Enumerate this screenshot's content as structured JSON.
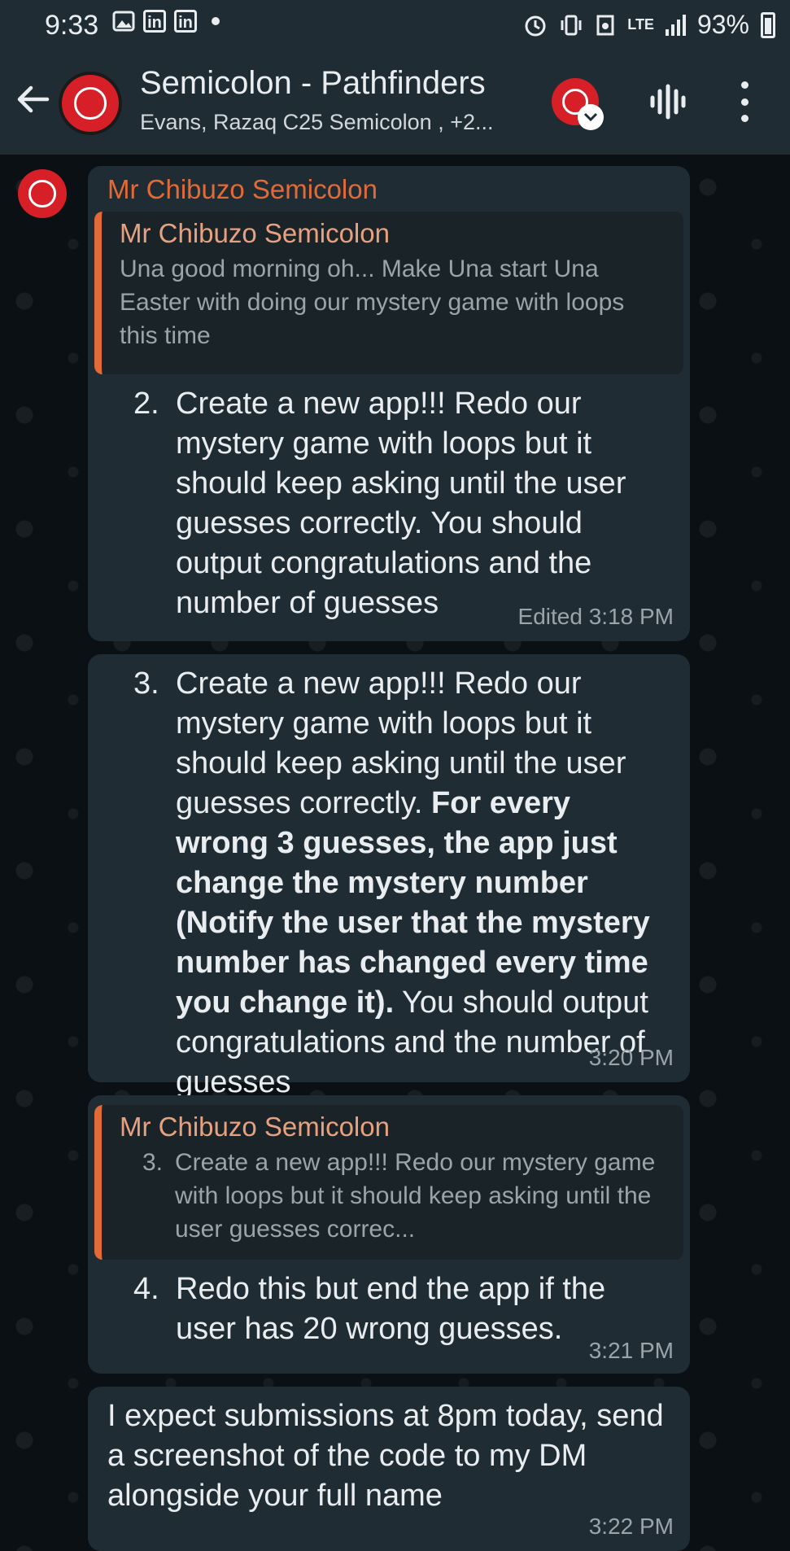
{
  "status_bar": {
    "time": "9:33",
    "network": "LTE",
    "battery": "93%"
  },
  "header": {
    "title": "Semicolon - Pathfinders",
    "subtitle": "Evans, Razaq C25 Semicolon , +2..."
  },
  "messages": [
    {
      "sender": "Mr Chibuzo Semicolon",
      "quote": {
        "sender": "Mr Chibuzo Semicolon",
        "text": "Una good morning oh... Make Una start Una Easter with doing our mystery game with loops this time"
      },
      "list_number": "2.",
      "text": "Create a new app!!! Redo our mystery game with loops but it should keep asking until the user guesses correctly. You should output congratulations and the number of guesses",
      "time": "Edited 3:18 PM"
    },
    {
      "list_number": "3.",
      "text_before": "Create a new app!!! Redo our mystery game with loops but it should keep asking until the user guesses correctly. ",
      "text_bold": "For every wrong 3 guesses, the app just change the mystery number (Notify the user that the mystery number has changed every time you change it).",
      "text_after": " You should output congratulations and the number of guesses",
      "time": "3:20 PM"
    },
    {
      "quote": {
        "sender": "Mr Chibuzo Semicolon",
        "list_number": "3.",
        "text": "Create a new app!!! Redo our mystery game with loops but it should keep asking until the user guesses correc..."
      },
      "list_number": "4.",
      "text": "Redo this but end the app if the user has 20 wrong guesses.",
      "time": "3:21 PM"
    },
    {
      "text": "I expect submissions at 8pm today, send a screenshot of the code to my DM alongside your full name",
      "time": "3:22 PM"
    }
  ],
  "colors": {
    "header_bg": "#1f2c33",
    "chat_bg": "#0b1014",
    "bubble_bg": "#202c33",
    "sender_name": "#e26a36",
    "avatar": "#d61f26"
  }
}
